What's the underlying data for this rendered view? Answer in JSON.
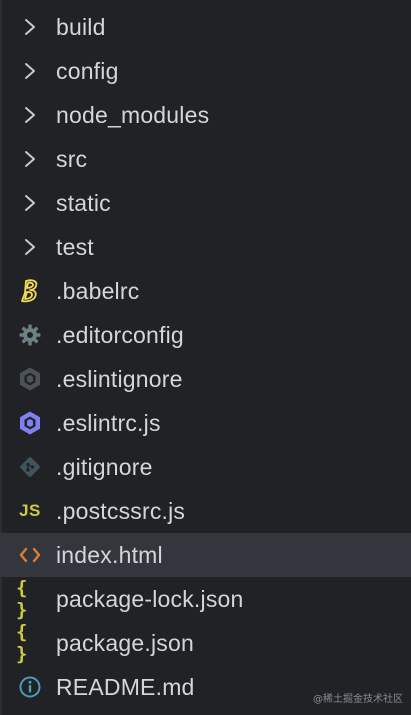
{
  "tree": {
    "folders": [
      {
        "label": "build",
        "icon": "chevron-right-icon"
      },
      {
        "label": "config",
        "icon": "chevron-right-icon"
      },
      {
        "label": "node_modules",
        "icon": "chevron-right-icon"
      },
      {
        "label": "src",
        "icon": "chevron-right-icon"
      },
      {
        "label": "static",
        "icon": "chevron-right-icon"
      },
      {
        "label": "test",
        "icon": "chevron-right-icon"
      }
    ],
    "files": [
      {
        "label": ".babelrc",
        "icon": "babel-icon"
      },
      {
        "label": ".editorconfig",
        "icon": "gear-icon"
      },
      {
        "label": ".eslintignore",
        "icon": "eslint-gray-icon"
      },
      {
        "label": ".eslintrc.js",
        "icon": "eslint-icon"
      },
      {
        "label": ".gitignore",
        "icon": "git-icon"
      },
      {
        "label": ".postcssrc.js",
        "icon": "js-icon"
      },
      {
        "label": "index.html",
        "icon": "html-icon"
      },
      {
        "label": "package-lock.json",
        "icon": "json-icon"
      },
      {
        "label": "package.json",
        "icon": "json-icon"
      },
      {
        "label": "README.md",
        "icon": "info-icon"
      }
    ],
    "js_glyph": "JS",
    "json_glyph": "{ }",
    "html_glyph": "<>"
  },
  "watermark": "@稀土掘金技术社区",
  "colors": {
    "background": "#202226",
    "text": "#d4d6da",
    "selected_row": "#33363c",
    "chevron": "#c8cacf",
    "babel": "#f5da55",
    "gear": "#6d8086",
    "eslint": "#8080f2",
    "git": "#41535b",
    "js": "#cbcb41",
    "html": "#e37933",
    "json": "#cbcb41",
    "info": "#519aba"
  }
}
